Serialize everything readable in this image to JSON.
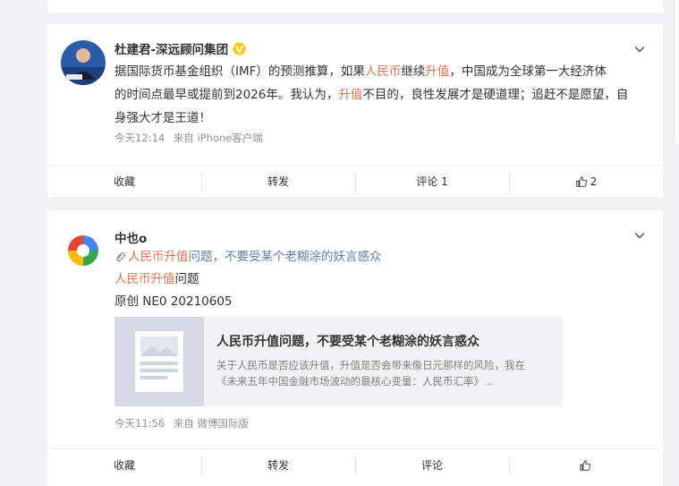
{
  "post1": {
    "author": "杜建君-深远顾问集团",
    "text": {
      "p1": "据国际货币基金组织（IMF）的预测推算，如果",
      "h1": "人民币",
      "p2": "继续",
      "h2": "升值",
      "p3": "，中国成为全球第一大经济体",
      "line2a": "的时间点最早或提前到2026年。我认为，",
      "h3": "升值",
      "line2b": "不目的，良性发展才是硬道理；追赶不是愿望，自",
      "line3": "身强大才是王道！"
    },
    "time": "今天12:14",
    "source": "来自 iPhone客户端",
    "actions": {
      "favorite": "收藏",
      "repost": "转发",
      "comment": "评论 1",
      "like_count": "2"
    }
  },
  "post2": {
    "author": "中也o",
    "link_line": {
      "h1": "人民币",
      "h2": "升值",
      "rest": "问题，不要受某个老糊涂的妖言惑众"
    },
    "line2": {
      "h1": "人民币",
      "h2": "升值",
      "rest": "问题"
    },
    "line3": "原创 NE0 20210605",
    "preview": {
      "title": "人民币升值问题，不要受某个老糊涂的妖言惑众",
      "desc1": "关于人民币是否应该升值，升值是否会带来像日元那样的风险，我在",
      "desc2": "《未来五年中国金融市场波动的最核心变量：人民币汇率》..."
    },
    "time": "今天11:56",
    "source": "来自 微博国际版",
    "actions": {
      "favorite": "收藏",
      "repost": "转发",
      "comment": "评论"
    }
  },
  "colors": {
    "highlight": "#eb7350",
    "meta": "#939393",
    "vip_badge": "#ffc800"
  }
}
